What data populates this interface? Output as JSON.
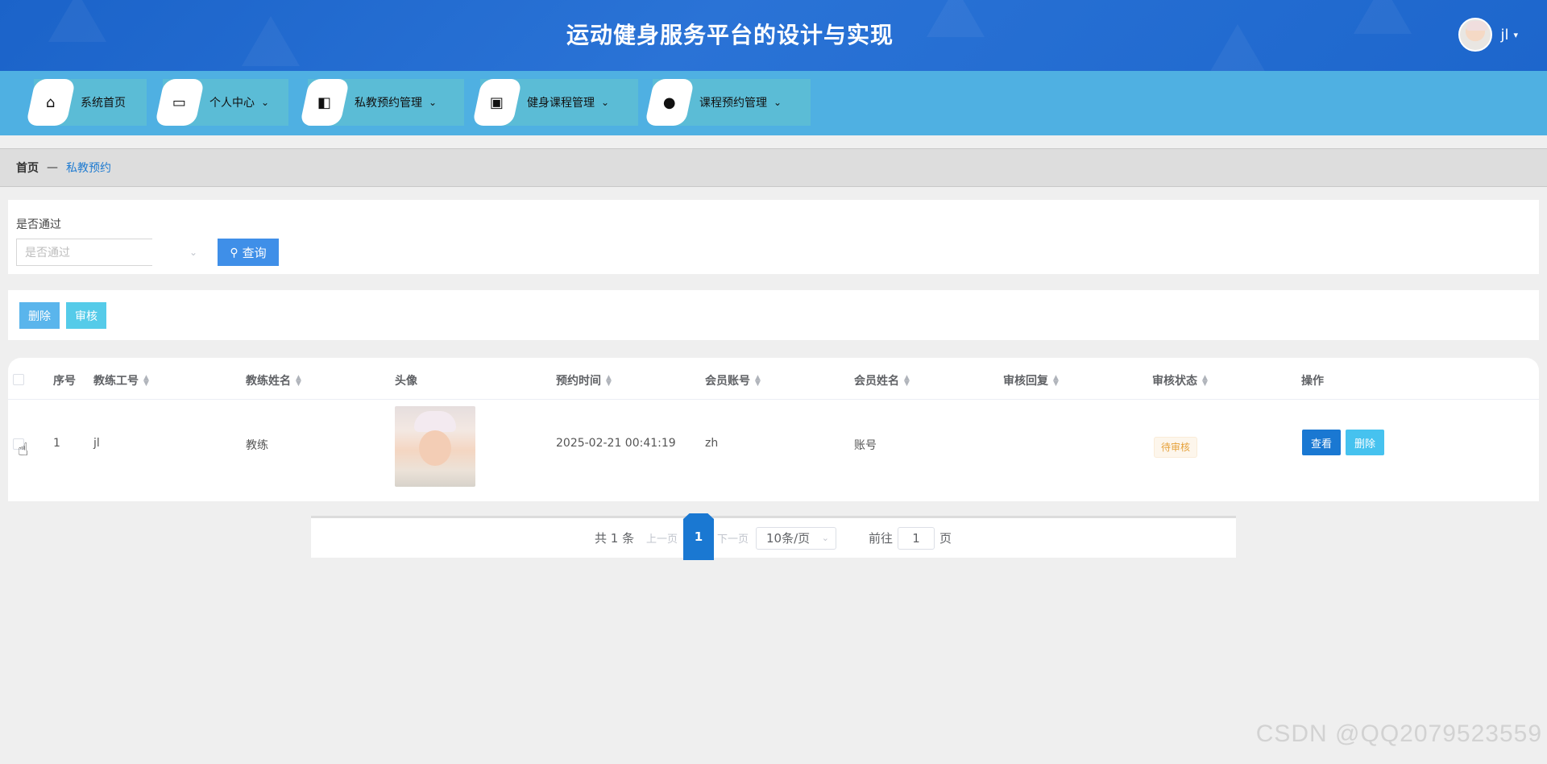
{
  "header": {
    "title": "运动健身服务平台的设计与实现",
    "username": "jl",
    "caret": "▾"
  },
  "nav": {
    "items": [
      {
        "label": "系统首页",
        "icon": "home-icon",
        "glyph": "⌂",
        "has_dropdown": false
      },
      {
        "label": "个人中心",
        "icon": "wallet-icon",
        "glyph": "▭",
        "has_dropdown": true
      },
      {
        "label": "私教预约管理",
        "icon": "briefcase-icon",
        "glyph": "◧",
        "has_dropdown": true
      },
      {
        "label": "健身课程管理",
        "icon": "clipboard-icon",
        "glyph": "▣",
        "has_dropdown": true
      },
      {
        "label": "课程预约管理",
        "icon": "bulb-icon",
        "glyph": "●",
        "has_dropdown": true
      }
    ],
    "chevron": "⌄"
  },
  "breadcrumb": {
    "home": "首页",
    "separator": "—",
    "current": "私教预约"
  },
  "search": {
    "label": "是否通过",
    "select_placeholder": "是否通过",
    "arrow": "⌄",
    "query_icon": "⚲",
    "query_label": "查询"
  },
  "actions": {
    "delete_label": "删除",
    "audit_label": "审核"
  },
  "table": {
    "columns": [
      "序号",
      "教练工号",
      "教练姓名",
      "头像",
      "预约时间",
      "会员账号",
      "会员姓名",
      "审核回复",
      "审核状态",
      "操作"
    ],
    "sort_up": "▲",
    "sort_down": "▼",
    "rows": [
      {
        "index": "1",
        "coach_id": "jl",
        "coach_name": "教练",
        "booking_time": "2025-02-21 00:41:19",
        "member_account": "zh",
        "member_name": "账号",
        "audit_reply": "",
        "status": "待审核",
        "view_label": "查看",
        "delete_label": "删除"
      }
    ]
  },
  "pagination": {
    "total": "共 1 条",
    "prev": "上一页",
    "current_page": "1",
    "next": "下一页",
    "page_size": "10条/页",
    "page_size_arrow": "⌄",
    "goto": "前往",
    "goto_value": "1",
    "goto_unit": "页"
  },
  "watermark": "CSDN @QQ2079523559",
  "colors": {
    "header_bg": "#1b63c9",
    "nav_bg": "#4fb0e2",
    "primary": "#1a78d2",
    "status_pending": "#e6a23c"
  }
}
